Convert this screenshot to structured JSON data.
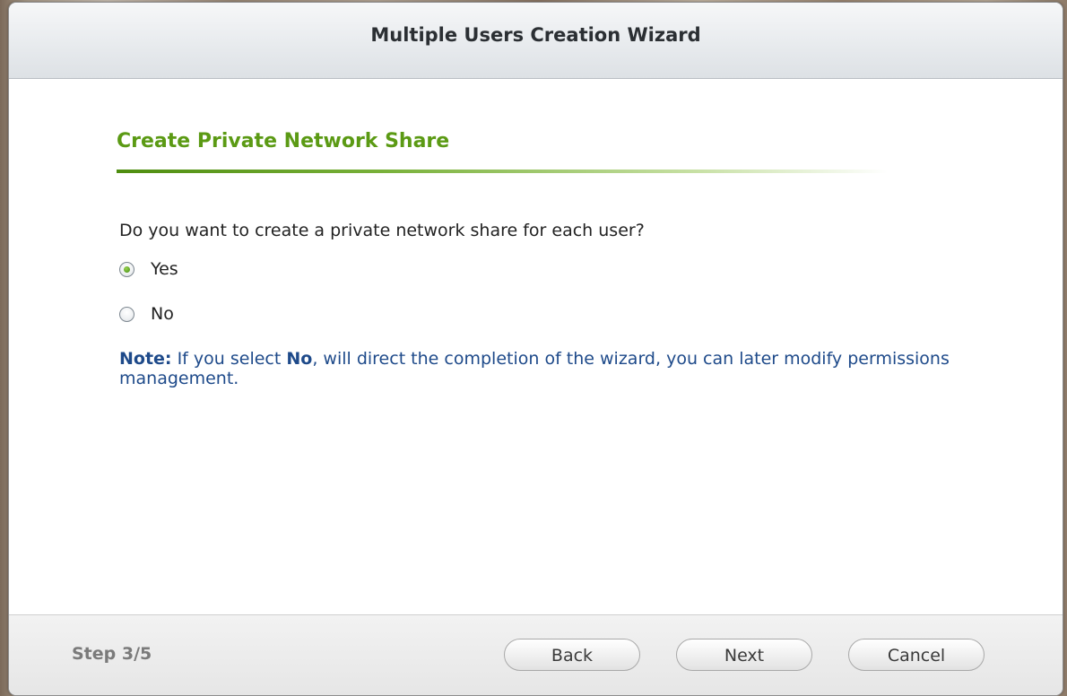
{
  "window": {
    "title": "Multiple Users Creation Wizard"
  },
  "content": {
    "section_title": "Create Private Network Share",
    "question": "Do you want to create a private network share for each user?",
    "options": [
      {
        "label": "Yes",
        "selected": true
      },
      {
        "label": "No",
        "selected": false
      }
    ],
    "note": {
      "prefix": "Note:",
      "text_before": " If you select ",
      "emphasis": "No",
      "text_after": ", will direct the completion of the wizard, you can later modify permissions management."
    }
  },
  "footer": {
    "step": "Step 3/5",
    "back_label": "Back",
    "next_label": "Next",
    "cancel_label": "Cancel"
  },
  "colors": {
    "accent_green": "#5b9a14",
    "note_blue": "#1e4a8a"
  }
}
